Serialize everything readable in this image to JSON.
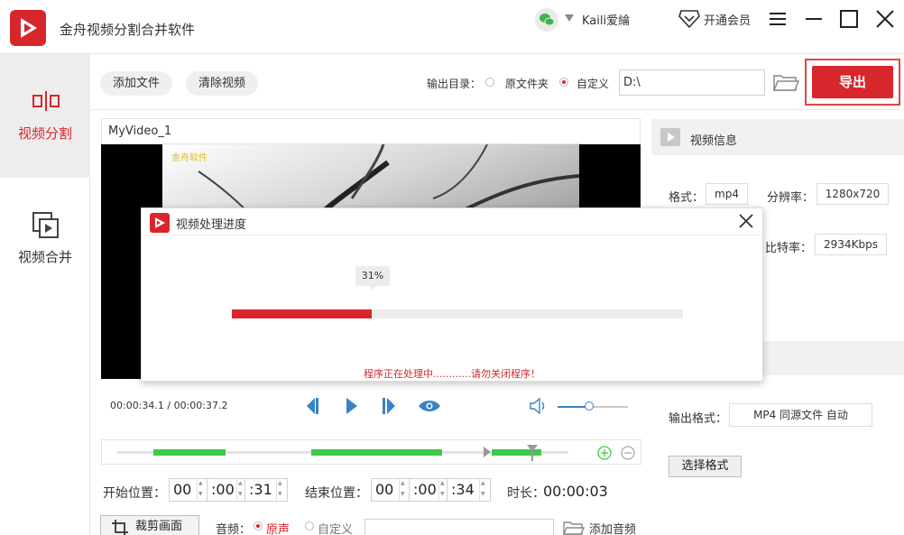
{
  "app": {
    "title": "金舟视频分割合并软件",
    "username": "Kaili爱綸",
    "vip_label": "开通会员",
    "brand_color": "#d8262d"
  },
  "sidebar": {
    "items": [
      {
        "label": "视频分割",
        "icon": "split-icon",
        "active": true
      },
      {
        "label": "视频合并",
        "icon": "merge-icon",
        "active": false
      }
    ]
  },
  "toolbar": {
    "add_file": "添加文件",
    "clear_video": "清除视频",
    "output_dir_label": "输出目录：",
    "option_source": "原文件夹",
    "option_custom": "自定义",
    "selected_option": "自定义",
    "path_value": "D:\\",
    "export_label": "导出"
  },
  "video": {
    "title": "MyVideo_1",
    "watermark": "金舟软件",
    "timecode": "00:00:34.1 / 00:00:37.2",
    "volume_level": 0.45
  },
  "timeline": {
    "segments": [
      {
        "start": 0.08,
        "end": 0.24
      },
      {
        "start": 0.43,
        "end": 0.72
      },
      {
        "start": 0.83,
        "end": 0.94
      }
    ],
    "playhead": 0.92
  },
  "trim": {
    "start_label": "开始位置：",
    "start": {
      "h": "00",
      "m": ":00",
      "s": ":31"
    },
    "end_label": "结束位置：",
    "end": {
      "h": "00",
      "m": ":00",
      "s": ":34"
    },
    "duration_label": "时长：",
    "duration": "00:00:03"
  },
  "bottom": {
    "crop_label": "裁剪画面",
    "audio_label": "音频：",
    "audio_original": "原声",
    "audio_custom": "自定义",
    "add_audio": "添加音频"
  },
  "info": {
    "header": "视频信息",
    "format_label": "格式：",
    "format_value": "mp4",
    "resolution_label": "分辨率：",
    "resolution_value": "1280x720",
    "bitrate_label": "比特率：",
    "bitrate_value": "2934Kbps",
    "output_format_label": "输出格式：",
    "output_format_value": "MP4 同源文件 自动",
    "choose_format": "选择格式"
  },
  "dialog": {
    "title": "视频处理进度",
    "percent_text": "31%",
    "progress": 0.31,
    "message": "程序正在处理中............请勿关闭程序！"
  }
}
